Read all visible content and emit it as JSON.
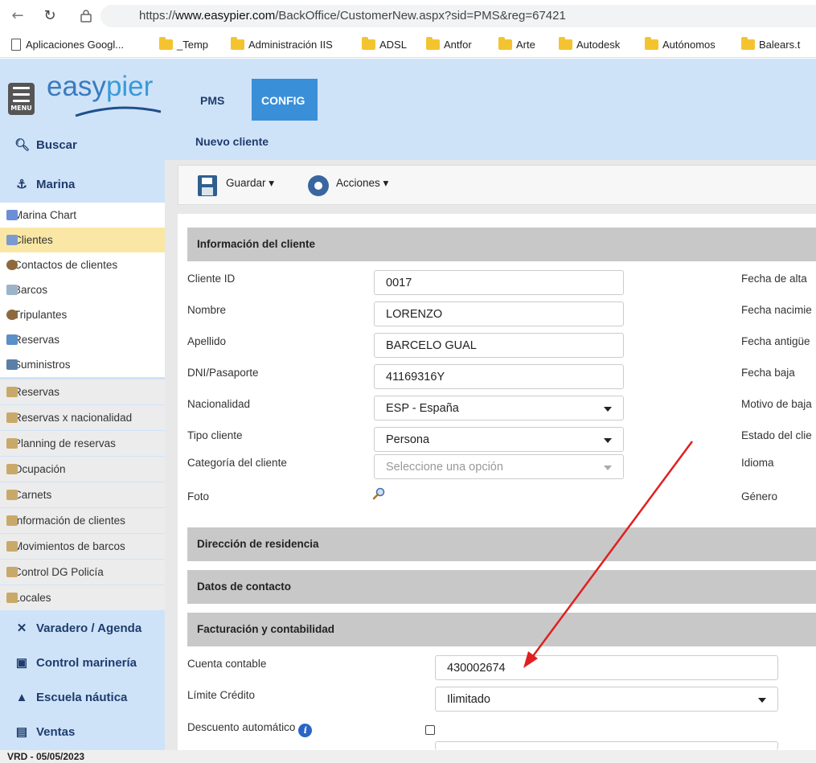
{
  "browser": {
    "url_prefix": "https://",
    "url_host": "www.easypier.com",
    "url_path": "/BackOffice/CustomerNew.aspx?sid=PMS&reg=67421",
    "bookmarks": [
      "Aplicaciones Googl...",
      "_Temp",
      "Administración IIS",
      "ADSL",
      "Antfor",
      "Arte",
      "Autodesk",
      "Autónomos",
      "Balears.t"
    ]
  },
  "app": {
    "menu_label": "MENU",
    "logo_easy": "easy",
    "logo_pier": "pier",
    "nav": [
      "PMS",
      "CONFIG"
    ],
    "breadcrumb": "Nuevo cliente"
  },
  "sidebar": {
    "buscar": "Buscar",
    "marina": "Marina",
    "items": [
      {
        "label": "Marina Chart",
        "color": "#6a8fd8"
      },
      {
        "label": "Clientes",
        "color": "#7a9ad0"
      },
      {
        "label": "Contactos de clientes",
        "color": "#8c6a3e"
      },
      {
        "label": "Barcos",
        "color": "#9db3c9"
      },
      {
        "label": "Tripulantes",
        "color": "#8c6a3e"
      },
      {
        "label": "Reservas",
        "color": "#5a8fc8"
      },
      {
        "label": "Suministros",
        "color": "#5a7fa8"
      }
    ],
    "reports": [
      "Reservas",
      "Reservas x nacionalidad",
      "Planning de reservas",
      "Ocupación",
      "Carnets",
      "Información de clientes",
      "Movimientos de barcos",
      "Control DG Policía",
      "Locales"
    ],
    "sections": [
      "Varadero / Agenda",
      "Control marinería",
      "Escuela náutica",
      "Ventas"
    ]
  },
  "toolbar": {
    "save_label": "Guardar",
    "actions_label": "Acciones"
  },
  "form": {
    "section_info": "Información del cliente",
    "cliente_id_label": "Cliente ID",
    "cliente_id": "0017",
    "nombre_label": "Nombre",
    "nombre": "LORENZO",
    "apellido_label": "Apellido",
    "apellido": "BARCELO GUAL",
    "dni_label": "DNI/Pasaporte",
    "dni": "41169316Y",
    "nacionalidad_label": "Nacionalidad",
    "nacionalidad": "ESP - España",
    "tipo_label": "Tipo cliente",
    "tipo": "Persona",
    "categoria_label": "Categoría del cliente",
    "categoria_placeholder": "Seleccione una opción",
    "foto_label": "Foto",
    "right_labels": [
      "Fecha de alta",
      "Fecha nacimie",
      "Fecha antigüe",
      "Fecha baja",
      "Motivo de baja",
      "Estado del clie",
      "Idioma",
      "Género"
    ],
    "section_direccion": "Dirección de residencia",
    "section_contacto": "Datos de contacto",
    "section_facturacion": "Facturación y contabilidad",
    "cuenta_label": "Cuenta contable",
    "cuenta": "430002674",
    "limite_label": "Límite Crédito",
    "limite": "Ilimitado",
    "descuento_label": "Descuento automático",
    "info_icon": "i"
  },
  "footer": {
    "version": "VRD - 05/05/2023"
  },
  "colors": {
    "accent": "#3a8fd9",
    "header_bg": "#cfe3f8",
    "annotation_arrow": "#e02020"
  }
}
